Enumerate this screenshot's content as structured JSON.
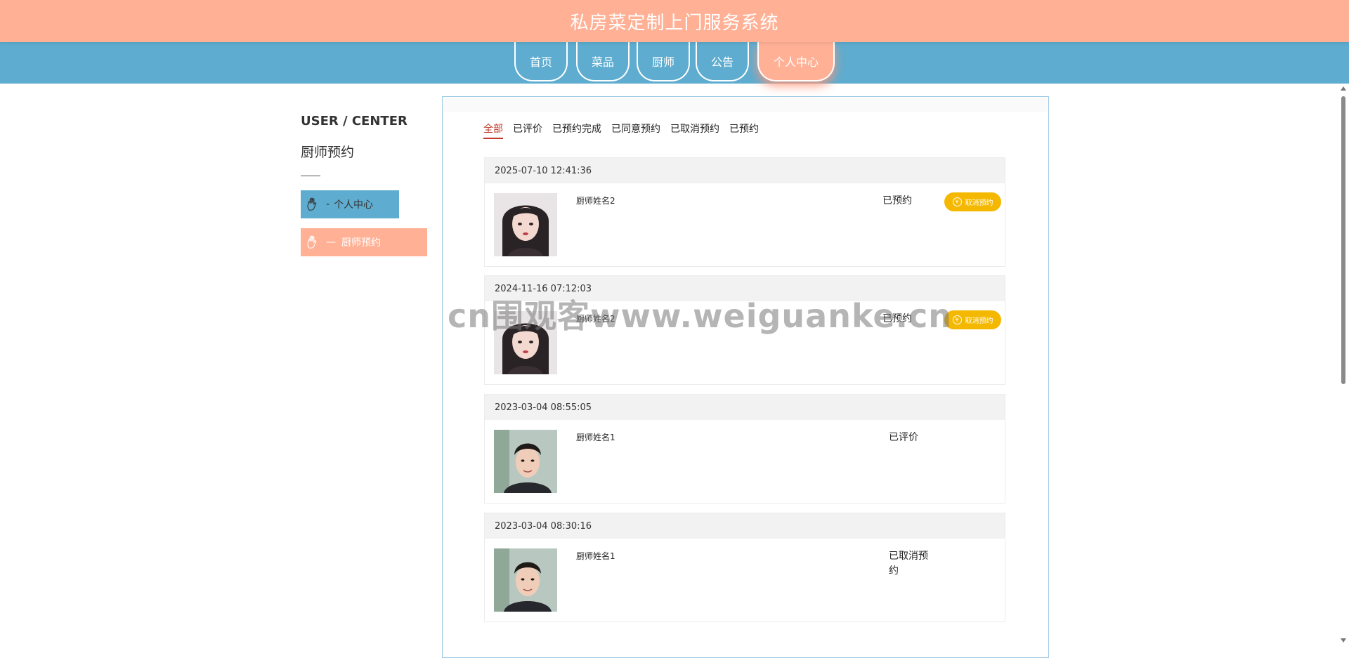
{
  "header": {
    "title": "私房菜定制上门服务系统"
  },
  "nav": {
    "items": [
      {
        "label": "首页"
      },
      {
        "label": "菜品"
      },
      {
        "label": "厨师"
      },
      {
        "label": "公告"
      },
      {
        "label": "个人中心",
        "active": true
      }
    ]
  },
  "sidebar": {
    "title_en": "USER / CENTER",
    "title_cn": "厨师预约",
    "items": [
      {
        "label": "个人中心",
        "icon": "hand-icon",
        "prefix": "-"
      },
      {
        "label": "厨师预约",
        "icon": "hand-icon",
        "prefix": "—",
        "active": true
      }
    ]
  },
  "tabs": {
    "items": [
      "全部",
      "已评价",
      "已预约完成",
      "已同意预约",
      "已取消预约",
      "已预约"
    ],
    "active": "全部"
  },
  "orders": [
    {
      "time": "2025-07-10 12:41:36",
      "chef": "厨师姓名2",
      "status": "已预约",
      "action": "取消预约"
    },
    {
      "time": "2024-11-16 07:12:03",
      "chef": "厨师姓名2",
      "status": "已预约",
      "action": "取消预约"
    },
    {
      "time": "2023-03-04 08:55:05",
      "chef": "厨师姓名1",
      "status": "已评价"
    },
    {
      "time": "2023-03-04 08:30:16",
      "chef": "厨师姓名1",
      "status": "已取消预约"
    }
  ],
  "watermark": "cn围观客www.weiguanke.cn",
  "colors": {
    "header": "#ffb095",
    "nav": "#5eaccf",
    "button": "#f5b800",
    "active_tab": "#c0392b"
  }
}
